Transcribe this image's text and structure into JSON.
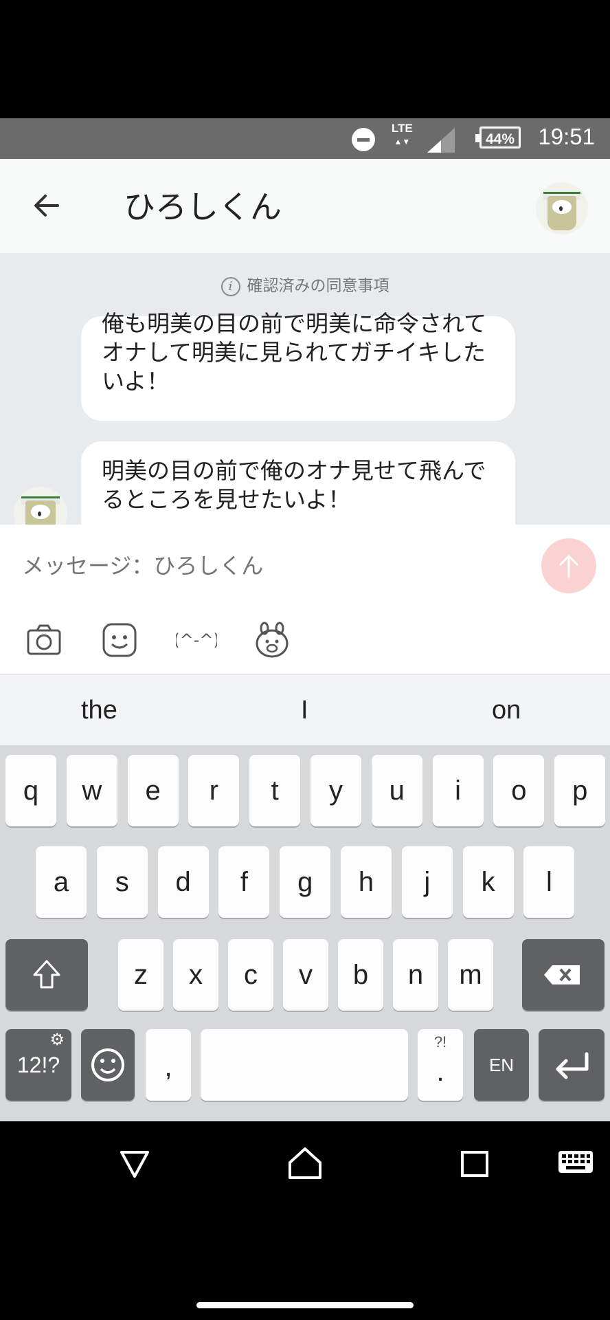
{
  "status_bar": {
    "time": "19:51",
    "network": "LTE",
    "battery": "44%",
    "icons": [
      "do-not-disturb-icon",
      "lte-icon",
      "signal-icon",
      "battery-icon"
    ]
  },
  "header": {
    "title": "ひろしくん",
    "back_icon": "arrow-left-icon"
  },
  "chat": {
    "notice": "確認済みの同意事項",
    "messages": [
      {
        "text": "俺も明美の目の前で明美に命令されてオナして明美に見られてガチイキしたいよ！"
      },
      {
        "text": "明美の目の前で俺のオナ見せて飛んでるところを見せたいよ！"
      }
    ]
  },
  "input": {
    "placeholder": "メッセージ：ひろしくん",
    "tools": [
      "camera-icon",
      "sticker-smiley-icon",
      "emoticon-icon",
      "character-sticker-icon"
    ]
  },
  "keyboard": {
    "suggestions": [
      "the",
      "I",
      "on"
    ],
    "row1": [
      "q",
      "w",
      "e",
      "r",
      "t",
      "y",
      "u",
      "i",
      "o",
      "p"
    ],
    "row2": [
      "a",
      "s",
      "d",
      "f",
      "g",
      "h",
      "j",
      "k",
      "l"
    ],
    "row3": [
      "z",
      "x",
      "c",
      "v",
      "b",
      "n",
      "m"
    ],
    "symbols_key": "12!?",
    "comma_key": ",",
    "period_key": ".",
    "period_hint": "?!",
    "lang_key": "EN"
  },
  "colors": {
    "status_bar": "#6b6b6b",
    "header": "#f7f8f8",
    "chat_bg": "#e8ebee",
    "send_button": "#fbd2d2",
    "key_dark": "#5f6163"
  }
}
